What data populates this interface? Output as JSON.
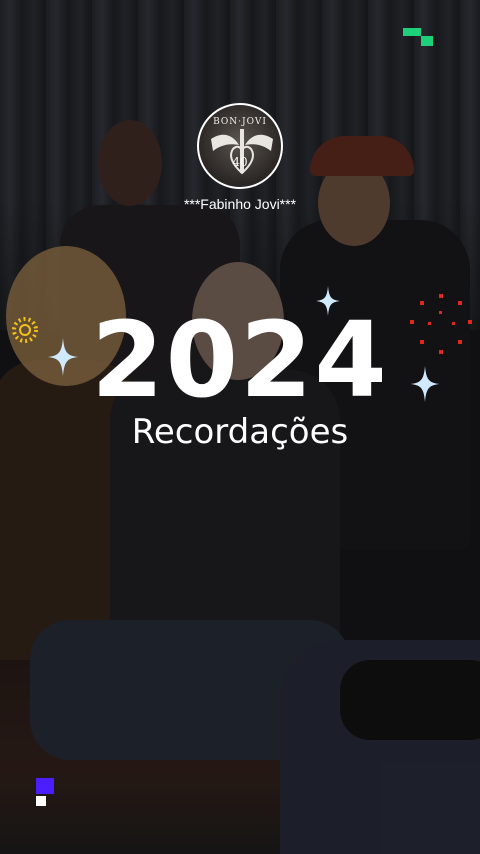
{
  "video": {
    "channel_name": "***Fabinho Jovi***",
    "year": "2024",
    "subtitle": "Recordações",
    "logo_text": "BON·JOVI",
    "logo_badge": "40"
  },
  "colors": {
    "text": "#ffffff",
    "corner_green": "#1fd07a",
    "corner_blue": "#4b1eff",
    "sparkle": "#bfe3ff",
    "ring_yellow": "#f2c21b",
    "ring_red": "#e0281e"
  },
  "icons": {
    "corner_top_right": "pixel-blocks-icon",
    "corner_bottom_left": "pixel-blocks-icon",
    "sparkles": "sparkle-icon",
    "dot_rings": "dot-ring-icon"
  }
}
